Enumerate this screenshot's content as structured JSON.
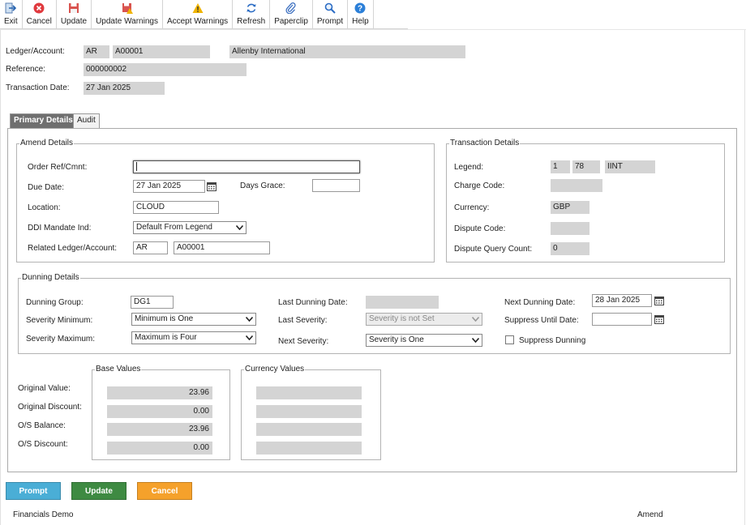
{
  "toolbar": {
    "items": [
      {
        "key": "exit",
        "label": "Exit",
        "icon": "exit-icon"
      },
      {
        "key": "cancel",
        "label": "Cancel",
        "icon": "cancel-icon"
      },
      {
        "key": "update",
        "label": "Update",
        "icon": "save-icon"
      },
      {
        "key": "update_warnings",
        "label": "Update Warnings",
        "icon": "save-warning-icon"
      },
      {
        "key": "accept_warnings",
        "label": "Accept Warnings",
        "icon": "warning-icon"
      },
      {
        "key": "refresh",
        "label": "Refresh",
        "icon": "refresh-icon"
      },
      {
        "key": "paperclip",
        "label": "Paperclip",
        "icon": "paperclip-icon"
      },
      {
        "key": "prompt",
        "label": "Prompt",
        "icon": "search-icon"
      },
      {
        "key": "help",
        "label": "Help",
        "icon": "help-icon"
      }
    ]
  },
  "header": {
    "ledger_account_label": "Ledger/Account:",
    "ledger": "AR",
    "account": "A00001",
    "account_name": "Allenby International",
    "reference_label": "Reference:",
    "reference": "000000002",
    "transaction_date_label": "Transaction Date:",
    "transaction_date": "27 Jan 2025"
  },
  "tabs": [
    {
      "label": "Primary Details",
      "active": true
    },
    {
      "label": "Audit",
      "active": false
    }
  ],
  "amend": {
    "legend": "Amend Details",
    "order_ref_label": "Order Ref/Cmnt:",
    "order_ref": "",
    "due_date_label": "Due Date:",
    "due_date": "27 Jan 2025",
    "days_grace_label": "Days Grace:",
    "days_grace": "",
    "location_label": "Location:",
    "location": "CLOUD",
    "ddi_label": "DDI Mandate Ind:",
    "ddi": "Default From Legend",
    "related_label": "Related Ledger/Account:",
    "related_ledger": "AR",
    "related_account": "A00001"
  },
  "transaction": {
    "legend": "Transaction Details",
    "legend_label": "Legend:",
    "legend_1": "1",
    "legend_2": "78",
    "legend_3": "IINT",
    "charge_code_label": "Charge Code:",
    "charge_code": "",
    "currency_label": "Currency:",
    "currency": "GBP",
    "dispute_code_label": "Dispute Code:",
    "dispute_code": "",
    "dispute_count_label": "Dispute Query Count:",
    "dispute_count": "0"
  },
  "dunning": {
    "legend": "Dunning Details",
    "group_label": "Dunning Group:",
    "group": "DG1",
    "sev_min_label": "Severity Minimum:",
    "sev_min": "Minimum is One",
    "sev_max_label": "Severity Maximum:",
    "sev_max": "Maximum is Four",
    "last_date_label": "Last Dunning Date:",
    "last_date": "",
    "last_sev_label": "Last Severity:",
    "last_sev": "Severity is not Set",
    "next_sev_label": "Next Severity:",
    "next_sev": "Severity is One",
    "next_date_label": "Next Dunning Date:",
    "next_date": "28 Jan 2025",
    "suppress_until_label": "Suppress Until Date:",
    "suppress_until": "",
    "suppress_label": "Suppress Dunning"
  },
  "values": {
    "base_legend": "Base Values",
    "currency_legend": "Currency Values",
    "original_value_label": "Original Value:",
    "original_discount_label": "Original Discount:",
    "os_balance_label": "O/S Balance:",
    "os_discount_label": "O/S Discount:",
    "base": [
      "23.96",
      "0.00",
      "23.96",
      "0.00"
    ],
    "currency": [
      "",
      "",
      "",
      ""
    ]
  },
  "buttons": {
    "prompt": "Prompt",
    "update": "Update",
    "cancel": "Cancel"
  },
  "footer": {
    "left": "Financials Demo",
    "right": "Amend"
  },
  "colors": {
    "prompt_button": "#4aaed6",
    "update_button": "#3e8a42",
    "cancel_button": "#f5a12b",
    "readonly_bg": "#d4d4d4",
    "active_tab": "#6f6f6f"
  }
}
